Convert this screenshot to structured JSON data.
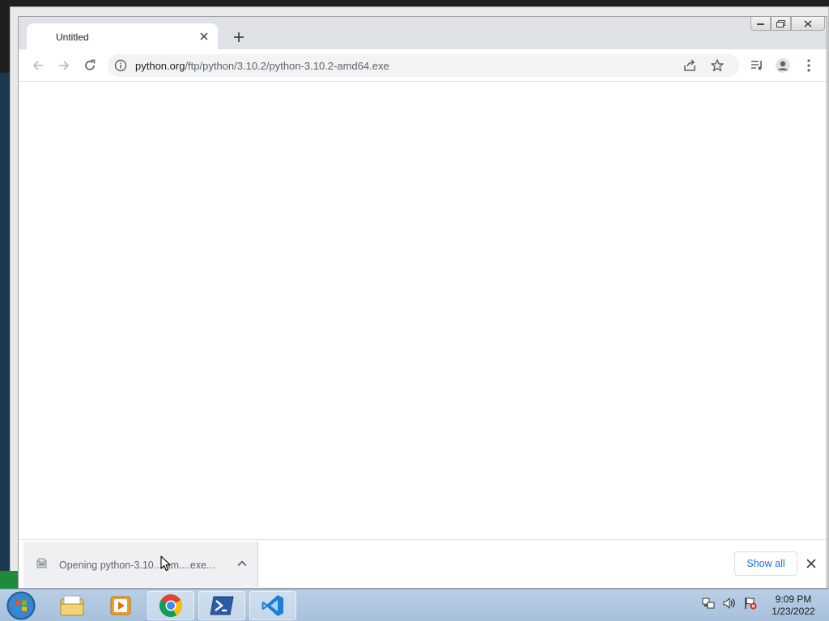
{
  "browser": {
    "tab_title": "Untitled",
    "url_host": "python.org",
    "url_path": "/ftp/python/3.10.2/python-3.10.2-amd64.exe"
  },
  "download_shelf": {
    "item_label": "Opening python-3.10....am....exe...",
    "show_all_label": "Show all"
  },
  "taskbar": {
    "apps": [
      "explorer-icon",
      "media-player-icon",
      "chrome-icon",
      "powershell-icon",
      "vscode-icon"
    ],
    "clock_time": "9:09 PM",
    "clock_date": "1/23/2022"
  },
  "colors": {
    "accent_blue": "#1a73e8",
    "tabstrip": "#dee1e6",
    "taskbar": "#b9cfe6"
  }
}
